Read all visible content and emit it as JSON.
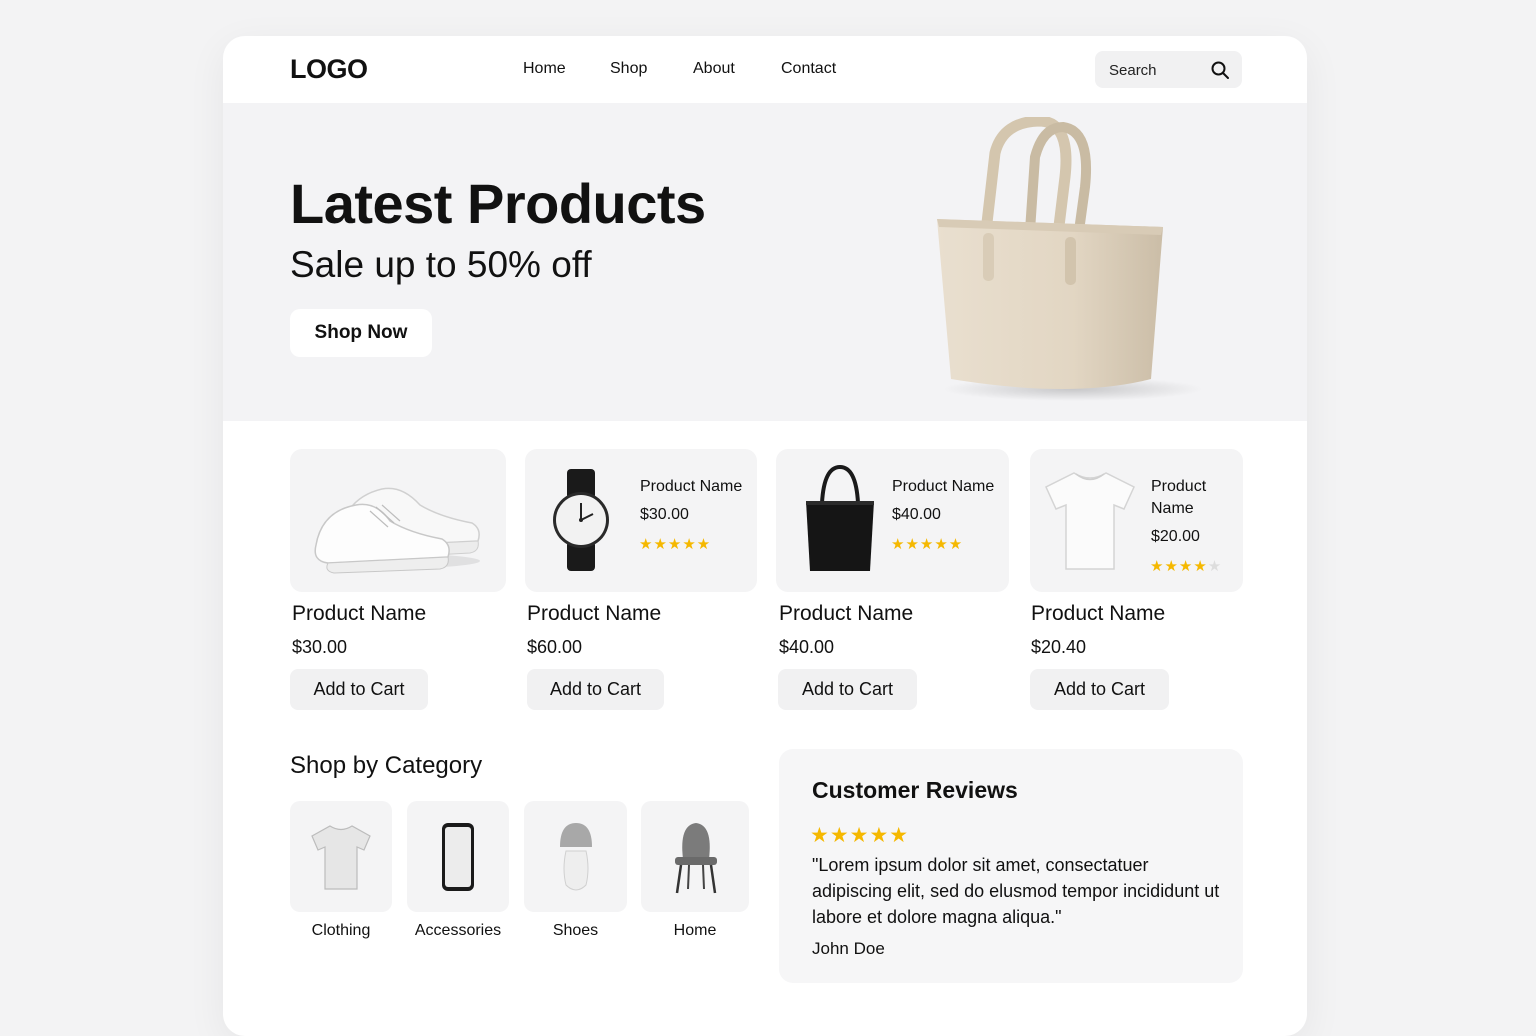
{
  "header": {
    "logo": "LOGO",
    "nav": [
      "Home",
      "Shop",
      "About",
      "Contact"
    ],
    "search_placeholder": "Search"
  },
  "hero": {
    "title": "Latest Products",
    "subtitle": "Sale up to 50% off",
    "cta": "Shop Now"
  },
  "products": [
    {
      "name": "Product Name",
      "price": "$30.00",
      "cart": "Add to Cart",
      "image": "sneaker"
    },
    {
      "name": "Product Name",
      "price": "$60.00",
      "cart": "Add to Cart",
      "image": "watch",
      "card_name": "Product Name",
      "card_price": "$30.00",
      "card_rating": 5
    },
    {
      "name": "Product Name",
      "price": "$40.00",
      "cart": "Add to Cart",
      "image": "tote-bag",
      "card_name": "Product Name",
      "card_price": "$40.00",
      "card_rating": 5
    },
    {
      "name": "Product Name",
      "price": "$20.40",
      "cart": "Add to Cart",
      "image": "t-shirt",
      "card_name": "Product Name",
      "card_price": "$20.00",
      "card_rating": 4
    }
  ],
  "category": {
    "title": "Shop by Category",
    "items": [
      {
        "label": "Clothing",
        "icon": "t-shirt"
      },
      {
        "label": "Accessories",
        "icon": "phone"
      },
      {
        "label": "Shoes",
        "icon": "lamp"
      },
      {
        "label": "Home",
        "icon": "chair"
      }
    ]
  },
  "reviews": {
    "title": "Customer Reviews",
    "rating": 5,
    "stars": "★★★★★",
    "quote": "\"Lorem ipsum dolor sit amet, consectatuer adipiscing elit, sed do elusmod tempor incididunt ut labore et dolore magna aliqua.\"",
    "author": "John Doe"
  },
  "colors": {
    "star": "#f5b800",
    "background": "#f3f3f4",
    "card": "#f4f4f5"
  }
}
